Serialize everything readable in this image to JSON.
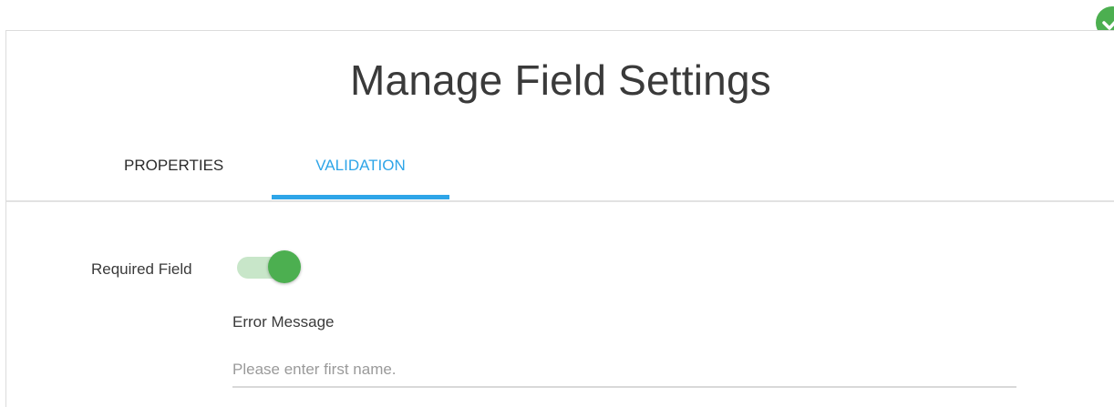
{
  "dialog": {
    "title": "Manage Field Settings"
  },
  "tabs": [
    {
      "label": "PROPERTIES",
      "active": false
    },
    {
      "label": "VALIDATION",
      "active": true
    }
  ],
  "validation": {
    "required_label": "Required Field",
    "required_enabled": true,
    "error_message_label": "Error Message",
    "error_message_value": "",
    "error_message_placeholder": "Please enter first name."
  },
  "colors": {
    "accent": "#2ea5e8",
    "toggle_on": "#4caf50",
    "toggle_track": "#c8e6c9"
  },
  "icons": {
    "corner_badge": "check-icon"
  }
}
